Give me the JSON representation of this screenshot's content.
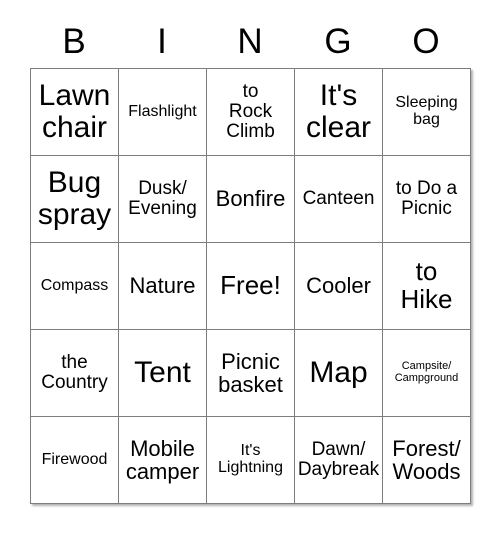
{
  "card": {
    "header_letters": [
      "B",
      "I",
      "N",
      "G",
      "O"
    ],
    "rows": [
      [
        {
          "text": "Lawn\nchair",
          "size": "fs-xxl"
        },
        {
          "text": "Flashlight",
          "size": "fs-sm"
        },
        {
          "text": "to\nRock\nClimb",
          "size": "fs-md"
        },
        {
          "text": "It's\nclear",
          "size": "fs-xxl"
        },
        {
          "text": "Sleeping\nbag",
          "size": "fs-sm"
        }
      ],
      [
        {
          "text": "Bug\nspray",
          "size": "fs-xxl"
        },
        {
          "text": "Dusk/\nEvening",
          "size": "fs-md"
        },
        {
          "text": "Bonfire",
          "size": "fs-lg"
        },
        {
          "text": "Canteen",
          "size": "fs-md"
        },
        {
          "text": "to Do a\nPicnic",
          "size": "fs-md"
        }
      ],
      [
        {
          "text": "Compass",
          "size": "fs-sm"
        },
        {
          "text": "Nature",
          "size": "fs-lg"
        },
        {
          "text": "Free!",
          "size": "fs-xl"
        },
        {
          "text": "Cooler",
          "size": "fs-lg"
        },
        {
          "text": "to\nHike",
          "size": "fs-xl"
        }
      ],
      [
        {
          "text": "the\nCountry",
          "size": "fs-md"
        },
        {
          "text": "Tent",
          "size": "fs-xxl"
        },
        {
          "text": "Picnic\nbasket",
          "size": "fs-lg"
        },
        {
          "text": "Map",
          "size": "fs-xxl"
        },
        {
          "text": "Campsite/\nCampground",
          "size": "fs-xxs"
        }
      ],
      [
        {
          "text": "Firewood",
          "size": "fs-sm"
        },
        {
          "text": "Mobile\ncamper",
          "size": "fs-lg"
        },
        {
          "text": "It's\nLightning",
          "size": "fs-sm"
        },
        {
          "text": "Dawn/\nDaybreak",
          "size": "fs-md"
        },
        {
          "text": "Forest/\nWoods",
          "size": "fs-lg"
        }
      ]
    ],
    "colors": {
      "background": "#ffffff",
      "grid_line": "#7d7d7d",
      "text": "#000000"
    }
  }
}
